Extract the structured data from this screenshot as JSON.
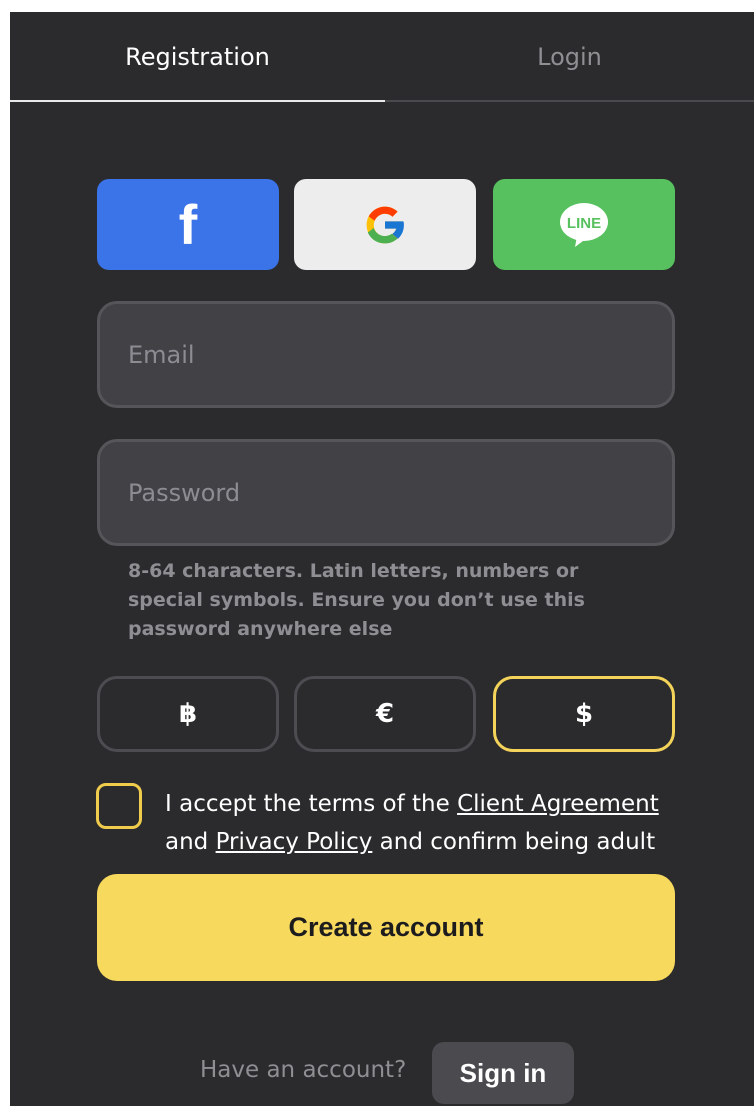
{
  "tabs": {
    "registration": "Registration",
    "login": "Login"
  },
  "social": [
    {
      "name": "facebook",
      "icon": "facebook-icon",
      "glyph": "f",
      "color": "#3b73e8"
    },
    {
      "name": "google",
      "icon": "google-icon",
      "color": "#ededee"
    },
    {
      "name": "line",
      "icon": "line-icon",
      "glyph": "LINE",
      "color": "#57c15f"
    }
  ],
  "form": {
    "email_placeholder": "Email",
    "email_value": "",
    "password_placeholder": "Password",
    "password_value": "",
    "password_hint": "8-64 characters. Latin letters, numbers or special symbols. Ensure you don’t use this password anywhere else"
  },
  "currencies": [
    {
      "symbol": "฿",
      "selected": false
    },
    {
      "symbol": "€",
      "selected": false
    },
    {
      "symbol": "$",
      "selected": true
    }
  ],
  "terms": {
    "checked": false,
    "text_before": "I accept the terms of the ",
    "link_agreement": "Client Agreement",
    "text_mid": " and ",
    "link_privacy": "Privacy Policy",
    "text_after": " and confirm being adult"
  },
  "create_button": "Create account",
  "footer": {
    "question": "Have an account?",
    "signin": "Sign in"
  },
  "colors": {
    "background": "#2b2b2d",
    "accent": "#f7d95d",
    "selected_border": "#f4d35a"
  }
}
